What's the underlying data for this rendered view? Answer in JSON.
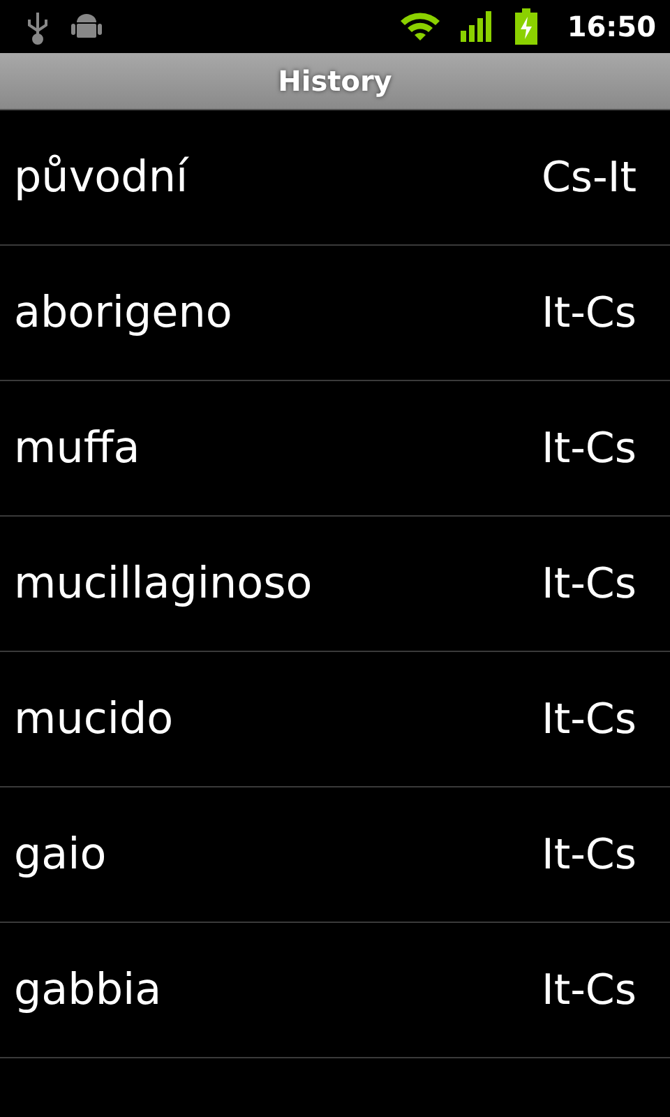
{
  "status_bar": {
    "time": "16:50"
  },
  "title": "History",
  "entries": [
    {
      "word": "původní",
      "direction": "Cs-It"
    },
    {
      "word": "aborigeno",
      "direction": "It-Cs"
    },
    {
      "word": "muffa",
      "direction": "It-Cs"
    },
    {
      "word": "mucillaginoso",
      "direction": "It-Cs"
    },
    {
      "word": "mucido",
      "direction": "It-Cs"
    },
    {
      "word": "gaio",
      "direction": "It-Cs"
    },
    {
      "word": "gabbia",
      "direction": "It-Cs"
    }
  ]
}
